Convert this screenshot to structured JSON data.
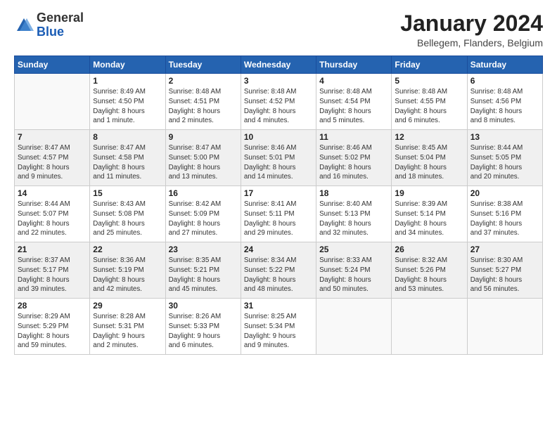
{
  "logo": {
    "general": "General",
    "blue": "Blue"
  },
  "title": "January 2024",
  "subtitle": "Bellegem, Flanders, Belgium",
  "days_header": [
    "Sunday",
    "Monday",
    "Tuesday",
    "Wednesday",
    "Thursday",
    "Friday",
    "Saturday"
  ],
  "weeks": [
    [
      {
        "num": "",
        "detail": ""
      },
      {
        "num": "1",
        "detail": "Sunrise: 8:49 AM\nSunset: 4:50 PM\nDaylight: 8 hours\nand 1 minute."
      },
      {
        "num": "2",
        "detail": "Sunrise: 8:48 AM\nSunset: 4:51 PM\nDaylight: 8 hours\nand 2 minutes."
      },
      {
        "num": "3",
        "detail": "Sunrise: 8:48 AM\nSunset: 4:52 PM\nDaylight: 8 hours\nand 4 minutes."
      },
      {
        "num": "4",
        "detail": "Sunrise: 8:48 AM\nSunset: 4:54 PM\nDaylight: 8 hours\nand 5 minutes."
      },
      {
        "num": "5",
        "detail": "Sunrise: 8:48 AM\nSunset: 4:55 PM\nDaylight: 8 hours\nand 6 minutes."
      },
      {
        "num": "6",
        "detail": "Sunrise: 8:48 AM\nSunset: 4:56 PM\nDaylight: 8 hours\nand 8 minutes."
      }
    ],
    [
      {
        "num": "7",
        "detail": "Sunrise: 8:47 AM\nSunset: 4:57 PM\nDaylight: 8 hours\nand 9 minutes."
      },
      {
        "num": "8",
        "detail": "Sunrise: 8:47 AM\nSunset: 4:58 PM\nDaylight: 8 hours\nand 11 minutes."
      },
      {
        "num": "9",
        "detail": "Sunrise: 8:47 AM\nSunset: 5:00 PM\nDaylight: 8 hours\nand 13 minutes."
      },
      {
        "num": "10",
        "detail": "Sunrise: 8:46 AM\nSunset: 5:01 PM\nDaylight: 8 hours\nand 14 minutes."
      },
      {
        "num": "11",
        "detail": "Sunrise: 8:46 AM\nSunset: 5:02 PM\nDaylight: 8 hours\nand 16 minutes."
      },
      {
        "num": "12",
        "detail": "Sunrise: 8:45 AM\nSunset: 5:04 PM\nDaylight: 8 hours\nand 18 minutes."
      },
      {
        "num": "13",
        "detail": "Sunrise: 8:44 AM\nSunset: 5:05 PM\nDaylight: 8 hours\nand 20 minutes."
      }
    ],
    [
      {
        "num": "14",
        "detail": "Sunrise: 8:44 AM\nSunset: 5:07 PM\nDaylight: 8 hours\nand 22 minutes."
      },
      {
        "num": "15",
        "detail": "Sunrise: 8:43 AM\nSunset: 5:08 PM\nDaylight: 8 hours\nand 25 minutes."
      },
      {
        "num": "16",
        "detail": "Sunrise: 8:42 AM\nSunset: 5:09 PM\nDaylight: 8 hours\nand 27 minutes."
      },
      {
        "num": "17",
        "detail": "Sunrise: 8:41 AM\nSunset: 5:11 PM\nDaylight: 8 hours\nand 29 minutes."
      },
      {
        "num": "18",
        "detail": "Sunrise: 8:40 AM\nSunset: 5:13 PM\nDaylight: 8 hours\nand 32 minutes."
      },
      {
        "num": "19",
        "detail": "Sunrise: 8:39 AM\nSunset: 5:14 PM\nDaylight: 8 hours\nand 34 minutes."
      },
      {
        "num": "20",
        "detail": "Sunrise: 8:38 AM\nSunset: 5:16 PM\nDaylight: 8 hours\nand 37 minutes."
      }
    ],
    [
      {
        "num": "21",
        "detail": "Sunrise: 8:37 AM\nSunset: 5:17 PM\nDaylight: 8 hours\nand 39 minutes."
      },
      {
        "num": "22",
        "detail": "Sunrise: 8:36 AM\nSunset: 5:19 PM\nDaylight: 8 hours\nand 42 minutes."
      },
      {
        "num": "23",
        "detail": "Sunrise: 8:35 AM\nSunset: 5:21 PM\nDaylight: 8 hours\nand 45 minutes."
      },
      {
        "num": "24",
        "detail": "Sunrise: 8:34 AM\nSunset: 5:22 PM\nDaylight: 8 hours\nand 48 minutes."
      },
      {
        "num": "25",
        "detail": "Sunrise: 8:33 AM\nSunset: 5:24 PM\nDaylight: 8 hours\nand 50 minutes."
      },
      {
        "num": "26",
        "detail": "Sunrise: 8:32 AM\nSunset: 5:26 PM\nDaylight: 8 hours\nand 53 minutes."
      },
      {
        "num": "27",
        "detail": "Sunrise: 8:30 AM\nSunset: 5:27 PM\nDaylight: 8 hours\nand 56 minutes."
      }
    ],
    [
      {
        "num": "28",
        "detail": "Sunrise: 8:29 AM\nSunset: 5:29 PM\nDaylight: 8 hours\nand 59 minutes."
      },
      {
        "num": "29",
        "detail": "Sunrise: 8:28 AM\nSunset: 5:31 PM\nDaylight: 9 hours\nand 2 minutes."
      },
      {
        "num": "30",
        "detail": "Sunrise: 8:26 AM\nSunset: 5:33 PM\nDaylight: 9 hours\nand 6 minutes."
      },
      {
        "num": "31",
        "detail": "Sunrise: 8:25 AM\nSunset: 5:34 PM\nDaylight: 9 hours\nand 9 minutes."
      },
      {
        "num": "",
        "detail": ""
      },
      {
        "num": "",
        "detail": ""
      },
      {
        "num": "",
        "detail": ""
      }
    ]
  ]
}
